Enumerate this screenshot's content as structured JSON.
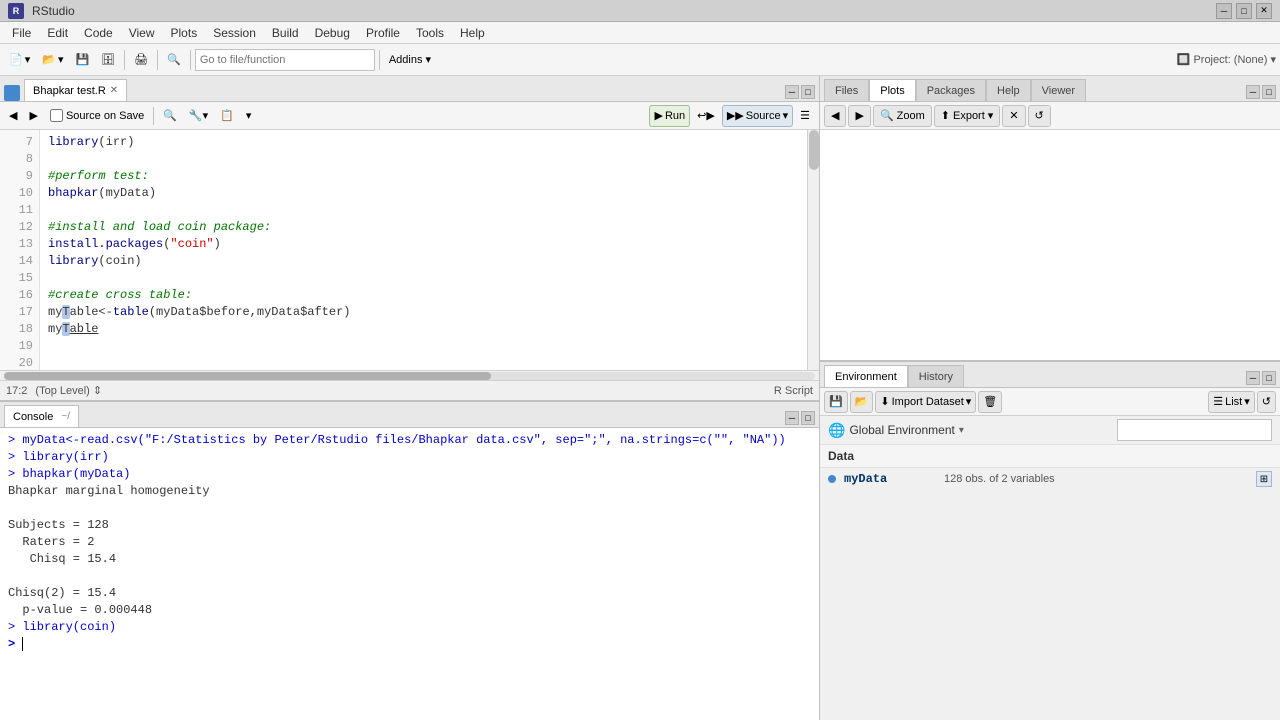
{
  "titlebar": {
    "title": "RStudio",
    "icon": "R"
  },
  "menubar": {
    "items": [
      "File",
      "Edit",
      "Code",
      "View",
      "Plots",
      "Session",
      "Build",
      "Debug",
      "Profile",
      "Tools",
      "Help"
    ]
  },
  "editor": {
    "tab_name": "Bhapkar test.R",
    "checkbox_label": "Source on Save",
    "run_label": "Run",
    "source_label": "Source",
    "lines": [
      {
        "num": "7",
        "code": "library(irr)",
        "type": "fn"
      },
      {
        "num": "8",
        "code": ""
      },
      {
        "num": "9",
        "code": "#perform test:",
        "type": "cm"
      },
      {
        "num": "10",
        "code": "bhapkar(myData)",
        "type": "fn"
      },
      {
        "num": "11",
        "code": ""
      },
      {
        "num": "12",
        "code": "#install and load coin package:",
        "type": "cm"
      },
      {
        "num": "13",
        "code": "install.packages(\"coin\")",
        "type": "fn"
      },
      {
        "num": "14",
        "code": "library(coin)",
        "type": "fn"
      },
      {
        "num": "15",
        "code": ""
      },
      {
        "num": "16",
        "code": "#create cross table:",
        "type": "cm"
      },
      {
        "num": "17",
        "code": "myTable<-table(myData$before,myData$after)",
        "type": "fn"
      },
      {
        "num": "18",
        "code": "myTable",
        "type": "fn"
      },
      {
        "num": "19",
        "code": ""
      }
    ],
    "statusbar": {
      "position": "17:2",
      "context": "(Top Level)",
      "script_type": "R Script"
    }
  },
  "console": {
    "tab_label": "Console",
    "path_indicator": "~/",
    "lines": [
      {
        "text": "> myData<-read.csv(\"F:/Statistics by Peter/Rstudio files/Bhapkar data.csv\", sep=\";\", na.strings=c(\"\", \"NA\"))",
        "type": "cmd"
      },
      {
        "text": "> library(irr)",
        "type": "cmd"
      },
      {
        "text": "> bhapkar(myData)",
        "type": "cmd"
      },
      {
        "text": "Bhapkar marginal homogeneity",
        "type": "output"
      },
      {
        "text": "",
        "type": "output"
      },
      {
        "text": "Subjects = 128",
        "type": "output"
      },
      {
        "text": "  Raters = 2",
        "type": "output"
      },
      {
        "text": "   Chisq = 15.4",
        "type": "output"
      },
      {
        "text": "",
        "type": "output"
      },
      {
        "text": "Chisq(2) = 15.4",
        "type": "output"
      },
      {
        "text": "  p-value = 0.000448",
        "type": "output"
      },
      {
        "text": "> library(coin)",
        "type": "cmd"
      },
      {
        "text": ">",
        "type": "prompt"
      }
    ]
  },
  "right_panel": {
    "top_tabs": [
      "Files",
      "Plots",
      "Packages",
      "Help",
      "Viewer"
    ],
    "active_top_tab": "Plots",
    "viewer_toolbar": {
      "back_label": "",
      "forward_label": "",
      "zoom_label": "Zoom",
      "export_label": "Export",
      "refresh_label": ""
    }
  },
  "env_panel": {
    "tabs": [
      "Environment",
      "History"
    ],
    "active_tab": "Environment",
    "import_btn": "Import Dataset",
    "list_btn": "List",
    "global_env": "Global Environment",
    "search_placeholder": "",
    "section_label": "Data",
    "items": [
      {
        "name": "myData",
        "description": "128 obs. of  2 variables"
      }
    ]
  }
}
